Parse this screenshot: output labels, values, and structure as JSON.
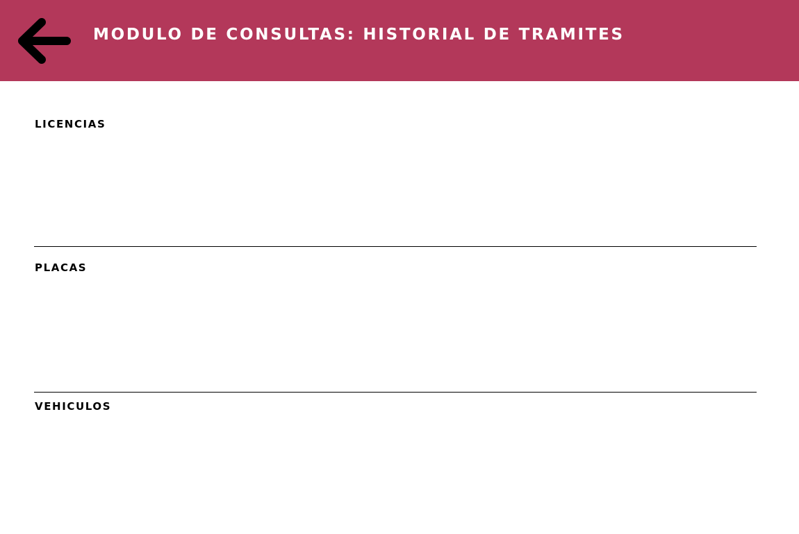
{
  "header": {
    "title": "MODULO DE CONSULTAS: HISTORIAL DE TRAMITES",
    "back_icon": "arrow-left-icon",
    "background_color": "#b3385a",
    "text_color": "#ffffff"
  },
  "sections": [
    {
      "title": "LICENCIAS"
    },
    {
      "title": "PLACAS"
    },
    {
      "title": "VEHICULOS"
    }
  ]
}
